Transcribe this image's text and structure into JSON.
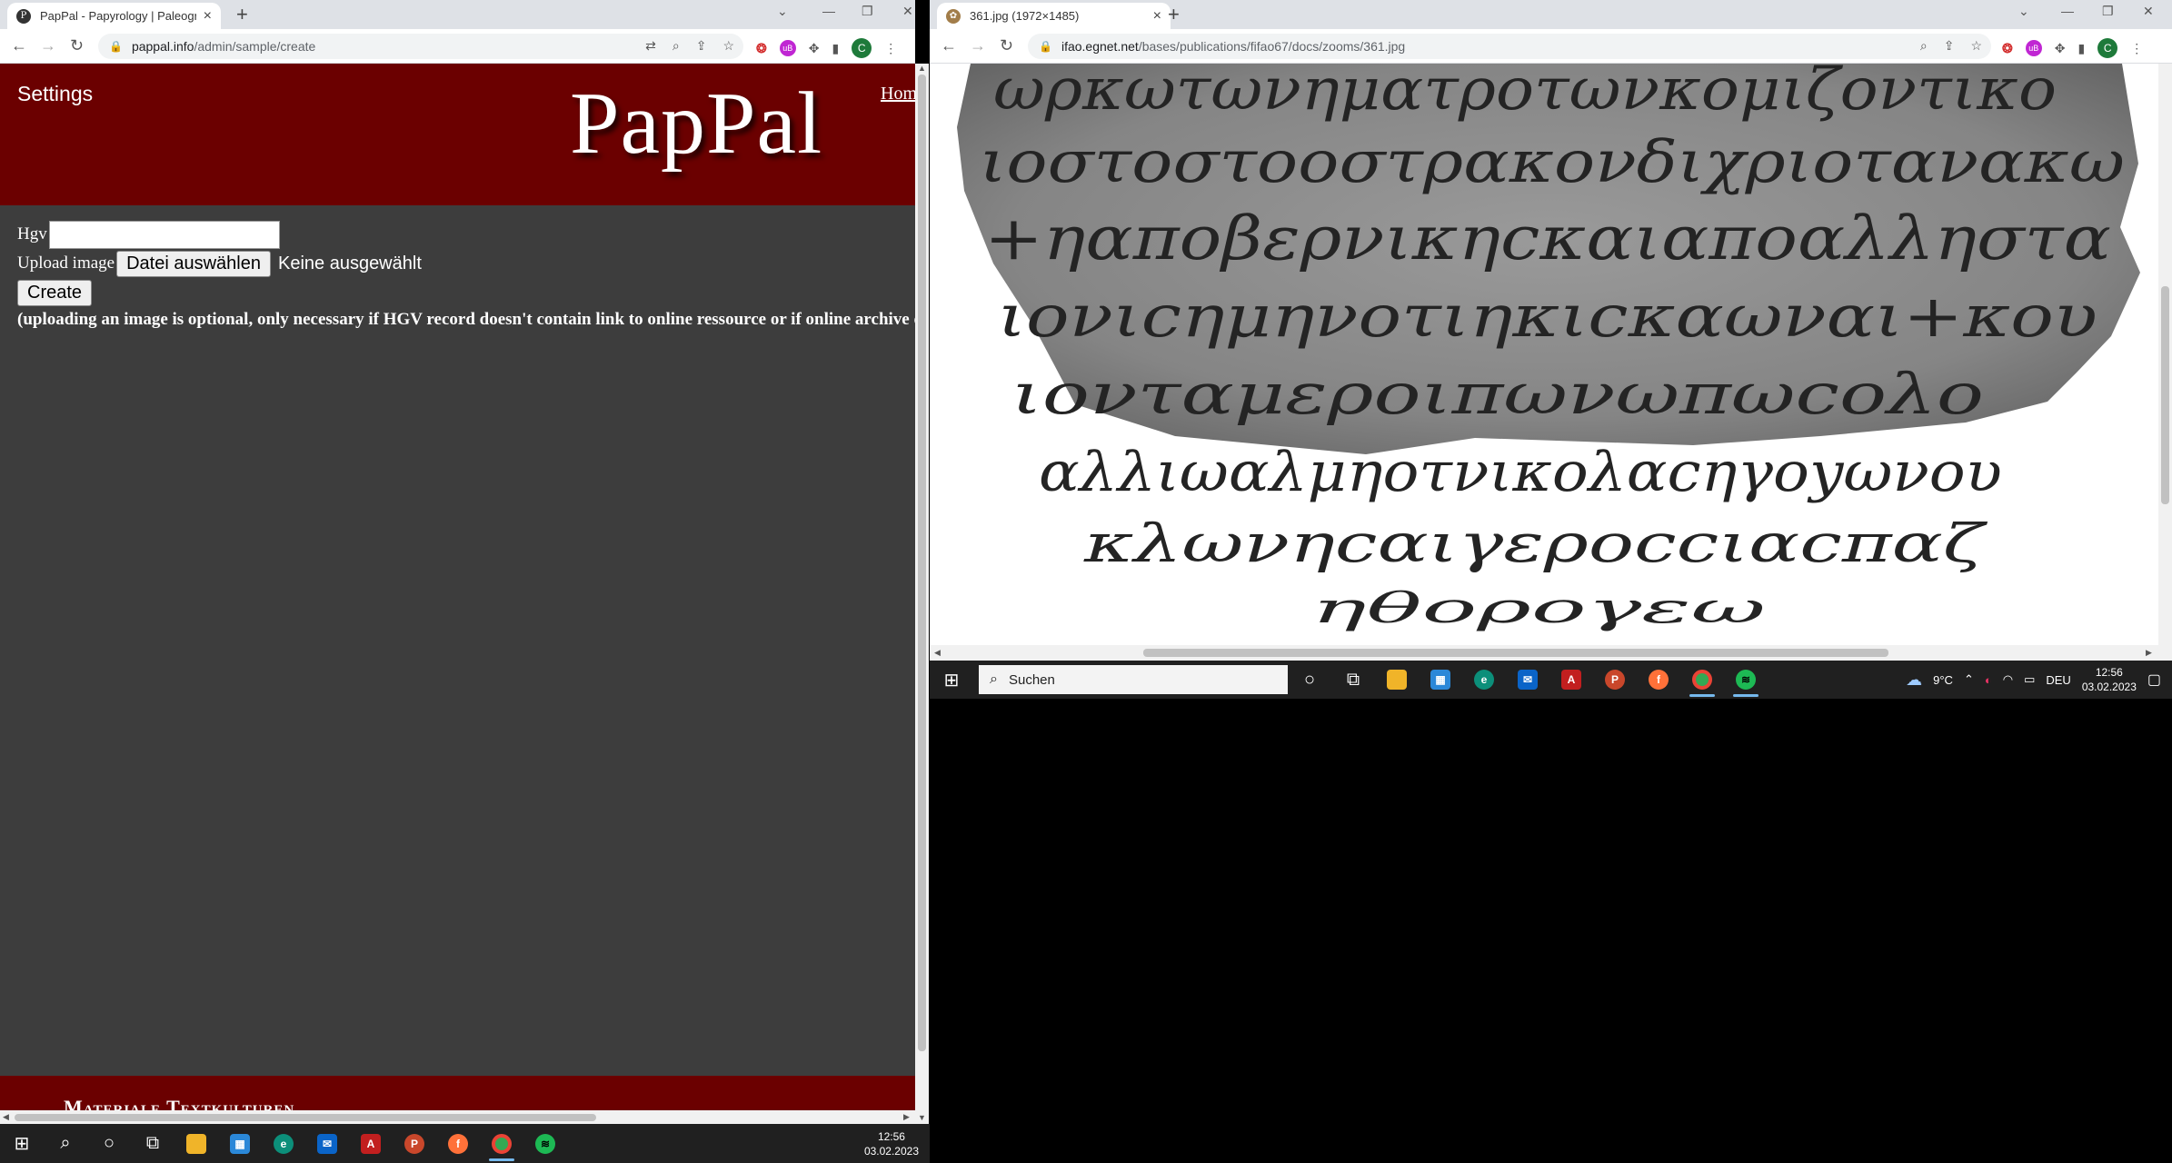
{
  "left_browser": {
    "tab_title": "PapPal - Papyrology | Paleography",
    "favicon_letter": "P",
    "url_host": "pappal.info",
    "url_path": "/admin/sample/create",
    "profile_letter": "C"
  },
  "pappal_page": {
    "settings": "Settings",
    "logo": "PapPal",
    "home_link": "Home",
    "hgv_label": "Hgv",
    "hgv_value": "",
    "upload_label": "Upload image",
    "choose_file": "Datei auswählen",
    "no_file": "Keine ausgewählt",
    "create": "Create",
    "hint": "(uploading an image is optional, only necessary if HGV record doesn't contain link to online ressource or if online archive does not allow",
    "footer": "Materiale Textkulturen"
  },
  "right_browser": {
    "tab_title": "361.jpg (1972×1485)",
    "url_host": "ifao.egnet.net",
    "url_path": "/bases/publications/fifao67/docs/zooms/361.jpg",
    "profile_letter": "C"
  },
  "ostracon_lines": [
    "ωρκωτωνηματροτωνκομιζοντικο",
    "ιοστοστοοστρακονδιχριοτανακω",
    "+ηαποβερνικηcκαιαποαλληστα",
    "ιονιcημηνοτιηκιcκαωναι+κου",
    "ιονταμεροιπωνωπωcολο",
    "αλλιωαλμηοτνικολαcηγοyωνου",
    "κλωνηcαιγεροccιαcπαζ",
    "ηθορογεω"
  ],
  "taskbar_right": {
    "search_placeholder": "Suchen",
    "weather": "9°C",
    "lang": "DEU",
    "time": "12:56",
    "date": "03.02.2023"
  },
  "taskbar_left": {
    "time": "12:56",
    "date": "03.02.2023"
  }
}
